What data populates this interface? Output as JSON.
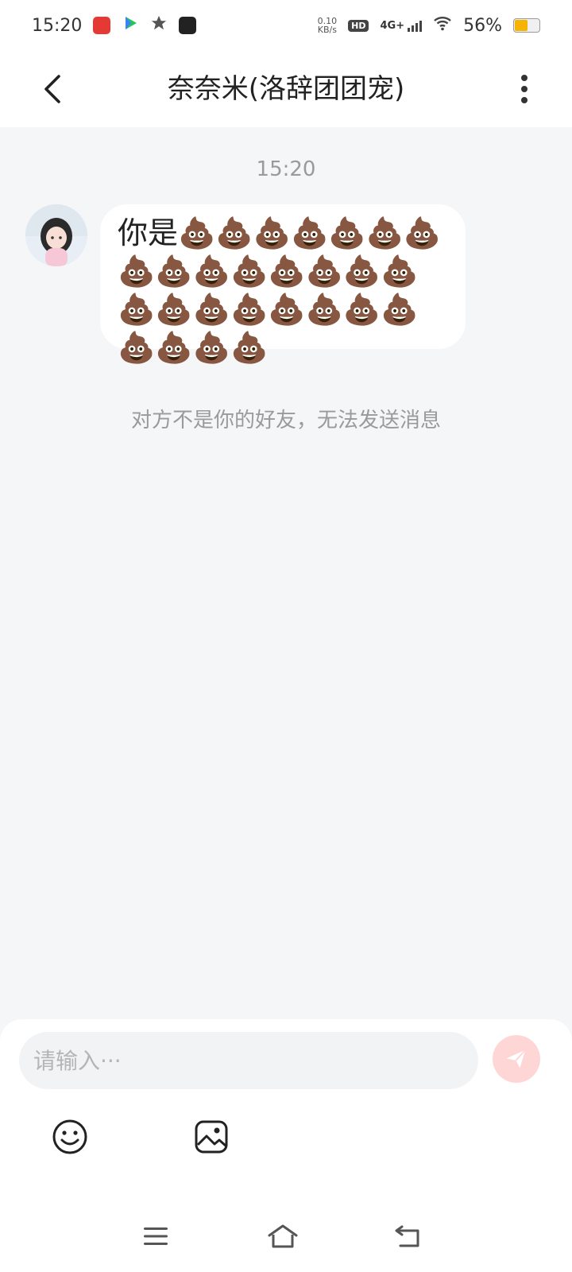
{
  "status_bar": {
    "time": "15:20",
    "net_speed_value": "0.10",
    "net_speed_unit": "KB/s",
    "hd_label": "HD",
    "network": "4G+",
    "battery_text": "56%",
    "battery_level": 0.56,
    "icons": [
      "app-icon-red",
      "video-app-icon",
      "star-icon",
      "soul-app-icon",
      "signal-icon",
      "wifi-icon",
      "battery-icon"
    ]
  },
  "header": {
    "title": "奈奈米(洛辞团团宠)",
    "icons": [
      "back-arrow-icon",
      "more-vertical-icon"
    ]
  },
  "chat": {
    "timestamp": "15:20",
    "message_text": "你是💩💩💩💩💩💩💩💩💩💩💩💩💩💩💩💩💩💩💩💩💩💩💩💩💩💩💩",
    "system_note": "对方不是你的好友，无法发送消息"
  },
  "composer": {
    "placeholder": "请输入···",
    "icons": [
      "send-icon",
      "emoji-icon",
      "image-icon"
    ]
  },
  "navbar": {
    "icons": [
      "menu-icon",
      "home-icon",
      "back-icon"
    ]
  },
  "colors": {
    "background": "#f5f6f8",
    "bubble": "#ffffff",
    "send_button": "#ffd6d6",
    "send_icon": "#ffffff",
    "muted_text": "#9a9a9a"
  }
}
